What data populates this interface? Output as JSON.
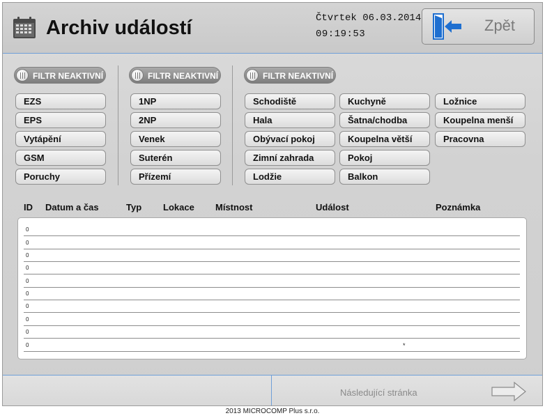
{
  "header": {
    "title": "Archiv událostí",
    "date": "Čtvrtek 06.03.2014",
    "time": "09:19:53",
    "back_label": "Zpět"
  },
  "filters": {
    "toggle_label": "FILTR NEAKTIVNÍ",
    "group1": [
      "EZS",
      "EPS",
      "Vytápění",
      "GSM",
      "Poruchy"
    ],
    "group2": [
      "1NP",
      "2NP",
      "Venek",
      "Suterén",
      "Přízemí"
    ],
    "group3_col1": [
      "Schodiště",
      "Hala",
      "Obývací pokoj",
      "Zimní zahrada",
      "Lodžie"
    ],
    "group3_col2": [
      "Kuchyně",
      "Šatna/chodba",
      "Koupelna větší",
      "Pokoj",
      "Balkon"
    ],
    "group3_col3": [
      "Ložnice",
      "Koupelna menší",
      "Pracovna"
    ]
  },
  "table": {
    "columns": [
      "ID",
      "Datum a čas",
      "Typ",
      "Lokace",
      "Místnost",
      "Událost",
      "Poznámka"
    ],
    "rows": [
      {
        "id": "0",
        "note": ""
      },
      {
        "id": "0",
        "note": ""
      },
      {
        "id": "0",
        "note": ""
      },
      {
        "id": "0",
        "note": ""
      },
      {
        "id": "0",
        "note": ""
      },
      {
        "id": "0",
        "note": ""
      },
      {
        "id": "0",
        "note": ""
      },
      {
        "id": "0",
        "note": ""
      },
      {
        "id": "0",
        "note": ""
      },
      {
        "id": "0",
        "note": "*"
      }
    ]
  },
  "footer": {
    "next_label": "Následující stránka",
    "copyright": "2013 MICROCOMP Plus s.r.o."
  },
  "icons": {
    "calendar": "calendar-icon",
    "back": "exit-door-arrow-icon",
    "next": "arrow-right-outline-icon"
  },
  "colors": {
    "accent_line": "#6f9fd8",
    "back_icon_blue": "#1e6fd0"
  }
}
